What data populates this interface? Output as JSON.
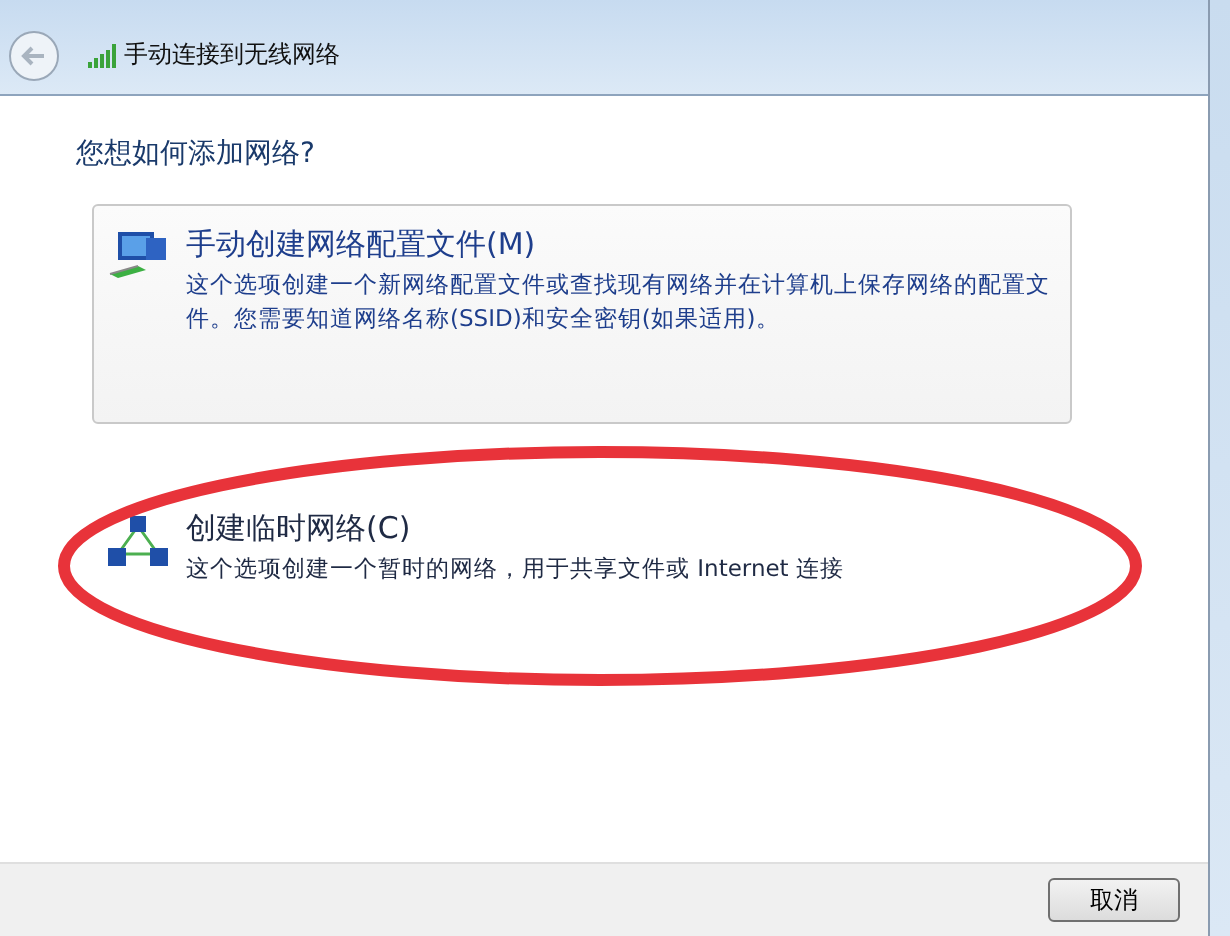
{
  "window": {
    "title": "手动连接到无线网络"
  },
  "heading": "您想如何添加网络?",
  "options": [
    {
      "kind": "profile",
      "title": "手动创建网络配置文件(M)",
      "description": "这个选项创建一个新网络配置文件或查找现有网络并在计算机上保存网络的配置文件。您需要知道网络名称(SSID)和安全密钥(如果适用)。",
      "selected": true,
      "circled": false
    },
    {
      "kind": "adhoc",
      "title": "创建临时网络(C)",
      "description": "这个选项创建一个暂时的网络，用于共享文件或 Internet 连接",
      "selected": false,
      "circled": true
    }
  ],
  "buttons": [
    "取消"
  ]
}
